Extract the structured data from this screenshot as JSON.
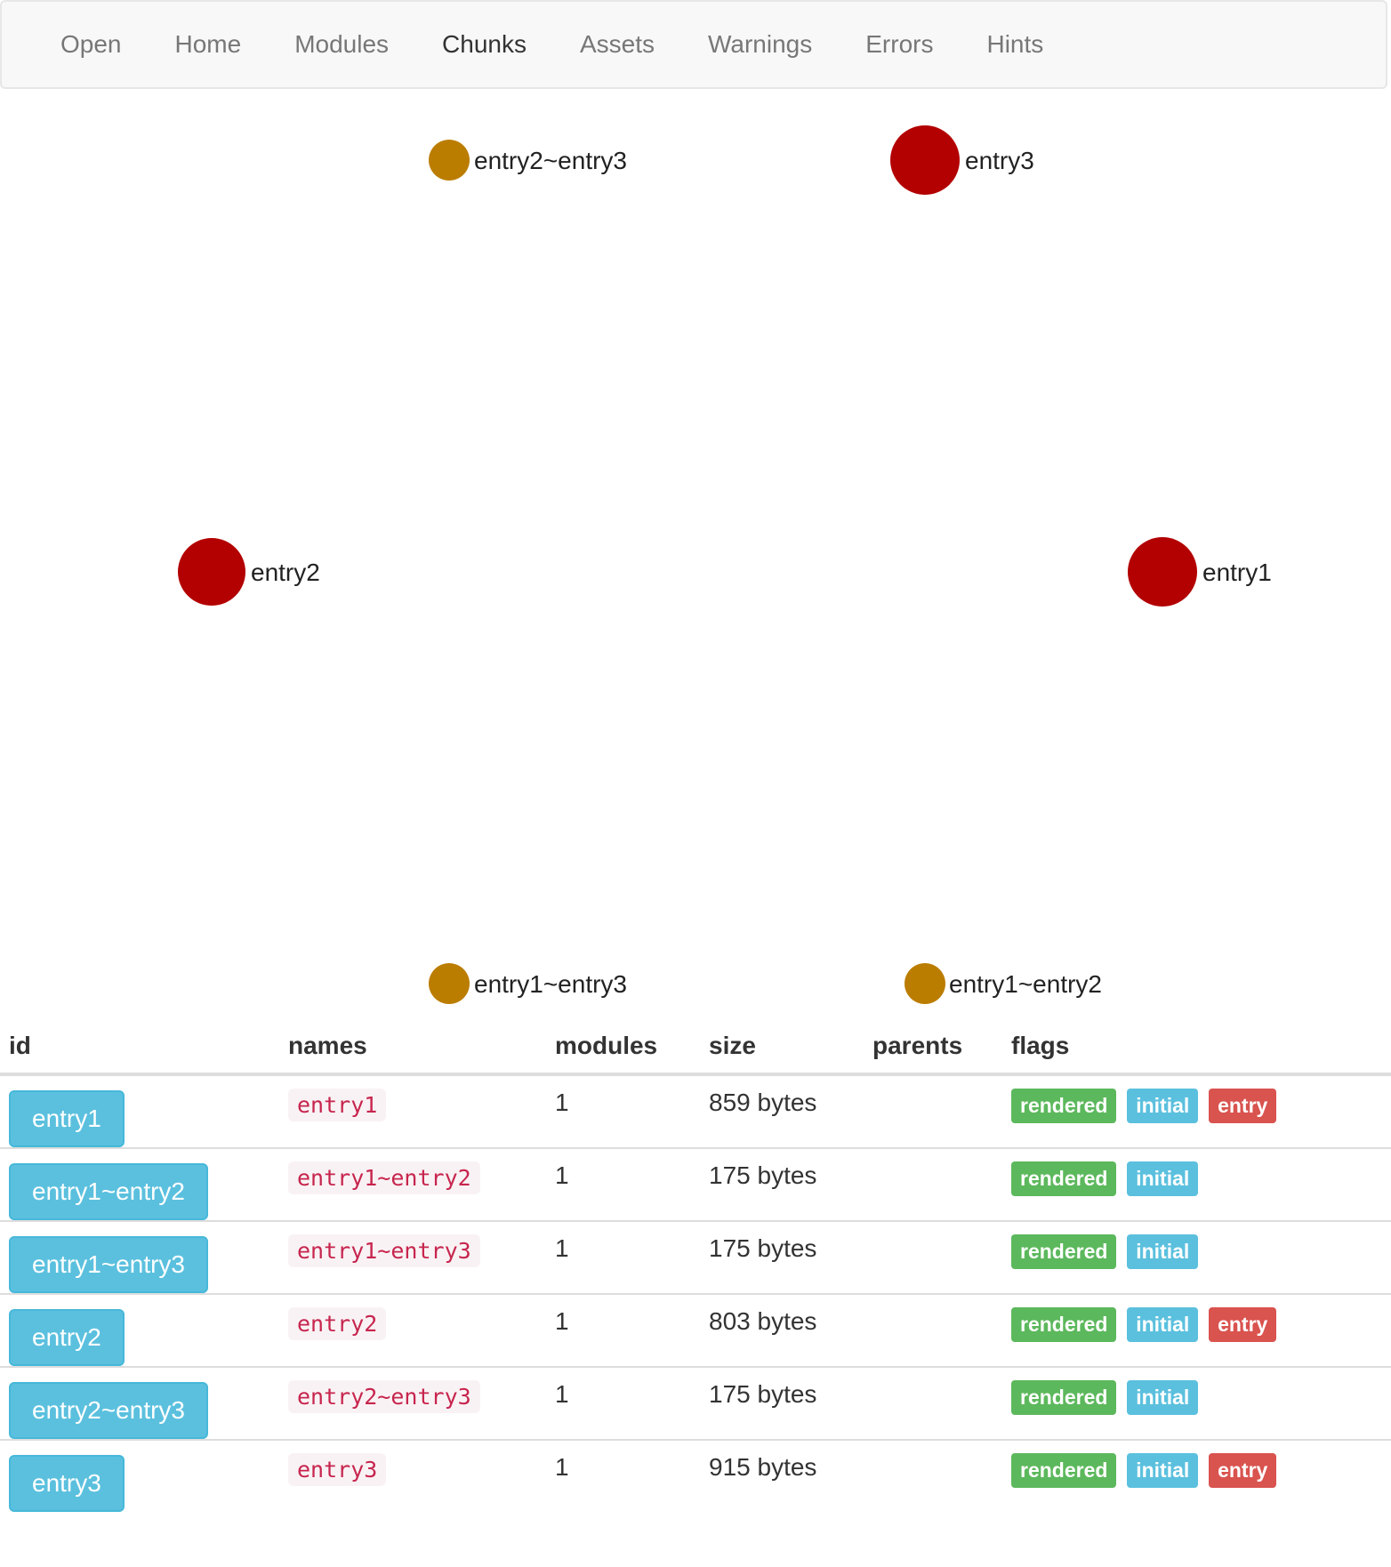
{
  "nav": {
    "items": [
      {
        "label": "Open",
        "active": false
      },
      {
        "label": "Home",
        "active": false
      },
      {
        "label": "Modules",
        "active": false
      },
      {
        "label": "Chunks",
        "active": true
      },
      {
        "label": "Assets",
        "active": false
      },
      {
        "label": "Warnings",
        "active": false
      },
      {
        "label": "Errors",
        "active": false
      },
      {
        "label": "Hints",
        "active": false
      }
    ]
  },
  "graph": {
    "colors": {
      "entry": "#b30000",
      "shared": "#bb7d00"
    },
    "nodes": [
      {
        "label": "entry2~entry3",
        "kind": "shared"
      },
      {
        "label": "entry3",
        "kind": "entry"
      },
      {
        "label": "entry2",
        "kind": "entry"
      },
      {
        "label": "entry1",
        "kind": "entry"
      },
      {
        "label": "entry1~entry3",
        "kind": "shared"
      },
      {
        "label": "entry1~entry2",
        "kind": "shared"
      }
    ]
  },
  "table": {
    "headers": {
      "id": "id",
      "names": "names",
      "modules": "modules",
      "size": "size",
      "parents": "parents",
      "flags": "flags"
    },
    "rows": [
      {
        "id": "entry1",
        "names": "entry1",
        "modules": "1",
        "size": "859 bytes",
        "parents": "",
        "flags": {
          "rendered": "rendered",
          "initial": "initial",
          "entry": "entry"
        }
      },
      {
        "id": "entry1~entry2",
        "names": "entry1~entry2",
        "modules": "1",
        "size": "175 bytes",
        "parents": "",
        "flags": {
          "rendered": "rendered",
          "initial": "initial"
        }
      },
      {
        "id": "entry1~entry3",
        "names": "entry1~entry3",
        "modules": "1",
        "size": "175 bytes",
        "parents": "",
        "flags": {
          "rendered": "rendered",
          "initial": "initial"
        }
      },
      {
        "id": "entry2",
        "names": "entry2",
        "modules": "1",
        "size": "803 bytes",
        "parents": "",
        "flags": {
          "rendered": "rendered",
          "initial": "initial",
          "entry": "entry"
        }
      },
      {
        "id": "entry2~entry3",
        "names": "entry2~entry3",
        "modules": "1",
        "size": "175 bytes",
        "parents": "",
        "flags": {
          "rendered": "rendered",
          "initial": "initial"
        }
      },
      {
        "id": "entry3",
        "names": "entry3",
        "modules": "1",
        "size": "915 bytes",
        "parents": "",
        "flags": {
          "rendered": "rendered",
          "initial": "initial",
          "entry": "entry"
        }
      }
    ]
  }
}
